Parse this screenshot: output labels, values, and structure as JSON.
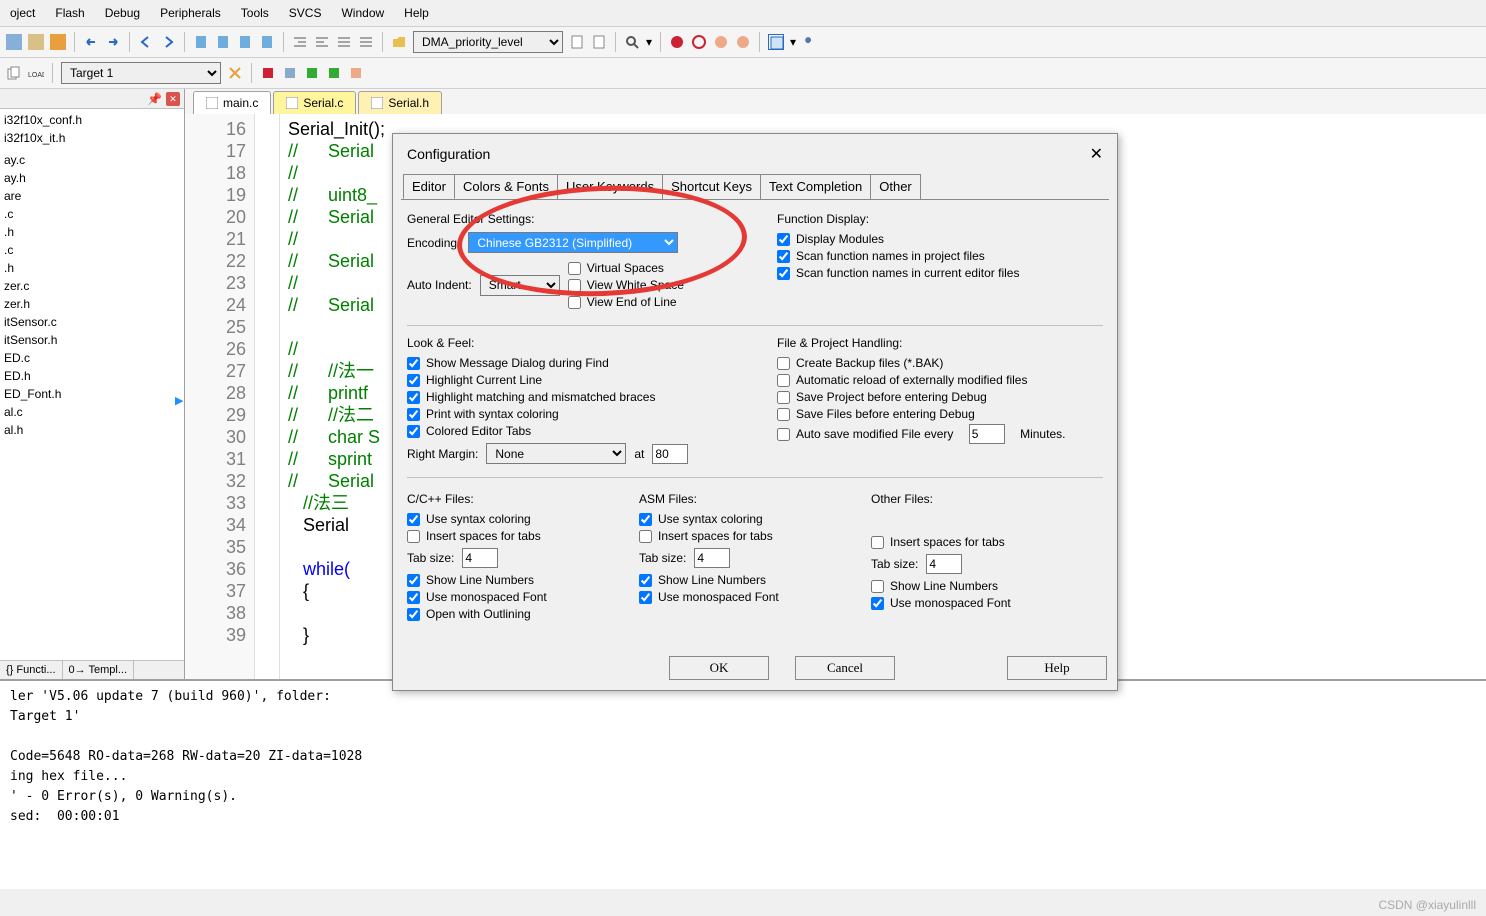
{
  "menu": {
    "items": [
      "oject",
      "Flash",
      "Debug",
      "Peripherals",
      "Tools",
      "SVCS",
      "Window",
      "Help"
    ]
  },
  "toolbar": {
    "combo1": "DMA_priority_level",
    "target": "Target 1"
  },
  "project": {
    "files": [
      "i32f10x_conf.h",
      "i32f10x_it.h",
      "",
      "ay.c",
      "ay.h",
      "are",
      ".c",
      ".h",
      ".c",
      ".h",
      "zer.c",
      "zer.h",
      "itSensor.c",
      "itSensor.h",
      "ED.c",
      "ED.h",
      "ED_Font.h",
      "al.c",
      "al.h"
    ],
    "tabs": [
      "{} Functi...",
      "0→ Templ..."
    ]
  },
  "editor": {
    "tabs": [
      {
        "name": "main.c",
        "style": "plain"
      },
      {
        "name": "Serial.c",
        "style": "active-yellow"
      },
      {
        "name": "Serial.h",
        "style": "active-orange"
      }
    ],
    "lines": [
      {
        "n": 16,
        "t": "Serial_Init();",
        "c": false
      },
      {
        "n": 17,
        "t": "//\tSerial",
        "c": true
      },
      {
        "n": 18,
        "t": "//\t",
        "c": true
      },
      {
        "n": 19,
        "t": "//\tuint8_",
        "c": true
      },
      {
        "n": 20,
        "t": "//\tSerial",
        "c": true
      },
      {
        "n": 21,
        "t": "//",
        "c": true
      },
      {
        "n": 22,
        "t": "//\tSerial",
        "c": true
      },
      {
        "n": 23,
        "t": "//\t",
        "c": true
      },
      {
        "n": 24,
        "t": "//\tSerial",
        "c": true
      },
      {
        "n": 25,
        "t": "",
        "c": false
      },
      {
        "n": 26,
        "t": "//\t",
        "c": true
      },
      {
        "n": 27,
        "t": "//\t//法一",
        "c": true
      },
      {
        "n": 28,
        "t": "//\tprintf",
        "c": true
      },
      {
        "n": 29,
        "t": "//\t//法二",
        "c": true
      },
      {
        "n": 30,
        "t": "//\tchar S",
        "c": true
      },
      {
        "n": 31,
        "t": "//\tsprint",
        "c": true
      },
      {
        "n": 32,
        "t": "//\tSerial",
        "c": true
      },
      {
        "n": 33,
        "t": "   //法三",
        "c": true
      },
      {
        "n": 34,
        "t": "   Serial",
        "c": false
      },
      {
        "n": 35,
        "t": "",
        "c": false
      },
      {
        "n": 36,
        "t": "   while(",
        "c": false,
        "kw": true
      },
      {
        "n": 37,
        "t": "   {",
        "c": false
      },
      {
        "n": 38,
        "t": "",
        "c": false
      },
      {
        "n": 39,
        "t": "   }",
        "c": false
      }
    ]
  },
  "output": "ler 'V5.06 update 7 (build 960)', folder:\nTarget 1'\n\nCode=5648 RO-data=268 RW-data=20 ZI-data=1028\ning hex file...\n' - 0 Error(s), 0 Warning(s).\nsed:  00:00:01",
  "dialog": {
    "title": "Configuration",
    "tabs": [
      "Editor",
      "Colors & Fonts",
      "User Keywords",
      "Shortcut Keys",
      "Text Completion",
      "Other"
    ],
    "general_label": "General Editor Settings:",
    "encoding_label": "Encoding:",
    "encoding_value": "Chinese GB2312 (Simplified)",
    "autoindent_label": "Auto Indent:",
    "autoindent_value": "Smart",
    "virtual_spaces": "Virtual Spaces",
    "view_white": "View White Space",
    "view_eol": "View End of Line",
    "function_display": "Function Display:",
    "fd1": "Display Modules",
    "fd2": "Scan function names in project files",
    "fd3": "Scan function names in current editor files",
    "look_feel": "Look & Feel:",
    "lf1": "Show Message Dialog during Find",
    "lf2": "Highlight Current Line",
    "lf3": "Highlight matching and mismatched braces",
    "lf4": "Print with syntax coloring",
    "lf5": "Colored Editor Tabs",
    "right_margin_label": "Right Margin:",
    "right_margin_value": "None",
    "right_margin_at": "at",
    "right_margin_num": "80",
    "fph": "File & Project Handling:",
    "fph1": "Create Backup files (*.BAK)",
    "fph2": "Automatic reload of externally modified files",
    "fph3": "Save Project before entering Debug",
    "fph4": "Save Files before entering Debug",
    "fph5_a": "Auto save modified File every",
    "fph5_val": "5",
    "fph5_b": "Minutes.",
    "cc_title": "C/C++ Files:",
    "asm_title": "ASM Files:",
    "other_title": "Other Files:",
    "opt_syntax": "Use syntax coloring",
    "opt_spaces": "Insert spaces for tabs",
    "opt_tabsize": "Tab size:",
    "tabsize_val": "4",
    "opt_linenum": "Show Line Numbers",
    "opt_mono": "Use monospaced Font",
    "opt_outline": "Open with Outlining",
    "btn_ok": "OK",
    "btn_cancel": "Cancel",
    "btn_help": "Help"
  },
  "watermark": "CSDN @xiayulinlll"
}
